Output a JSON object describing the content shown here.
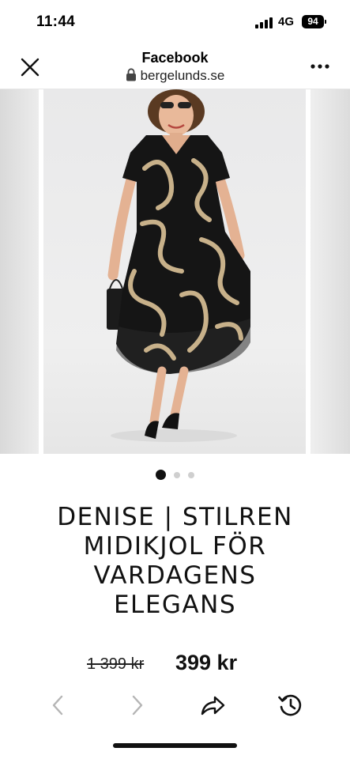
{
  "status_bar": {
    "time": "11:44",
    "network": "4G",
    "battery": "94"
  },
  "header": {
    "title": "Facebook",
    "url": "bergelunds.se",
    "close_icon": "close-icon",
    "more_icon": "more-icon",
    "lock_icon": "lock-icon"
  },
  "gallery": {
    "image": "product-photo",
    "dots": 3,
    "active_dot": 1
  },
  "product": {
    "title_lines": [
      "DENISE | STILREN",
      "MIDIKJOL FÖR",
      "VARDAGENS",
      "ELEGANS"
    ],
    "old_price": "1 399 kr",
    "price": "399 kr"
  },
  "toolbar": {
    "back_icon": "chevron-left-icon",
    "forward_icon": "chevron-right-icon",
    "share_icon": "share-icon",
    "history_icon": "history-icon"
  },
  "colors": {
    "text": "#111111",
    "disabled": "#b5b5b5",
    "dress": "#151515",
    "print": "#c8b18a"
  }
}
